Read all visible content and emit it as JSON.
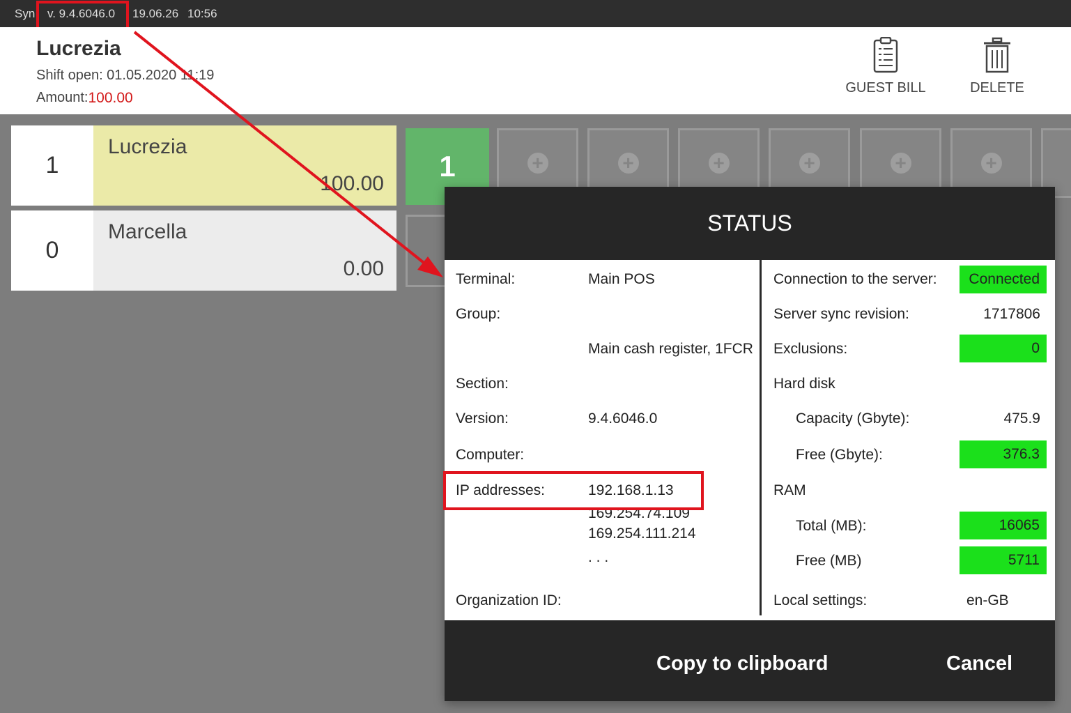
{
  "topbar": {
    "app_prefix": "Syn",
    "version": "v. 9.4.6046.0",
    "date": "19.06.26",
    "time": "10:56"
  },
  "header": {
    "name": "Lucrezia",
    "shift_open": "Shift open: 01.05.2020 11:19",
    "amount_label": "Amount:",
    "amount_value": "100.00",
    "guest_bill_label": "GUEST BILL",
    "delete_label": "DELETE"
  },
  "tables": [
    {
      "number": "1",
      "name": "Lucrezia",
      "amount": "100.00",
      "color": "#ebeaa8"
    },
    {
      "number": "0",
      "name": "Marcella",
      "amount": "0.00",
      "color": "#ececec"
    }
  ],
  "tiles": {
    "active_label": "1",
    "add_glyph": "+"
  },
  "status": {
    "title": "STATUS",
    "left": {
      "terminal_label": "Terminal:",
      "terminal_value": "Main POS",
      "group_label": "Group:",
      "group_value": "Main cash register, 1FCR",
      "section_label": "Section:",
      "version_label": "Version:",
      "version_value": "9.4.6046.0",
      "computer_label": "Computer:",
      "ip_label": "IP addresses:",
      "ip_1": "192.168.1.13",
      "ip_2": "169.254.74.109",
      "ip_3": "169.254.111.214",
      "ip_more": ". . .",
      "org_label": "Organization ID:"
    },
    "right": {
      "connection_label": "Connection to the server:",
      "connection_value": "Connected",
      "sync_label": "Server sync revision:",
      "sync_value": "1717806",
      "exclusions_label": "Exclusions:",
      "exclusions_value": "0",
      "hdd_label": "Hard disk",
      "capacity_label": "Capacity (Gbyte):",
      "capacity_value": "475.9",
      "free_g_label": "Free (Gbyte):",
      "free_g_value": "376.3",
      "ram_label": "RAM",
      "total_mb_label": "Total (MB):",
      "total_mb_value": "16065",
      "free_mb_label": "Free (MB)",
      "free_mb_value": "5711",
      "local_label": "Local settings:",
      "local_value": "en-GB"
    },
    "copy_label": "Copy to clipboard",
    "cancel_label": "Cancel"
  },
  "colors": {
    "highlight": "#e0141e",
    "status_ok": "#1be01b",
    "amount_red": "#d31a1a",
    "active_tile": "#62b56a"
  }
}
